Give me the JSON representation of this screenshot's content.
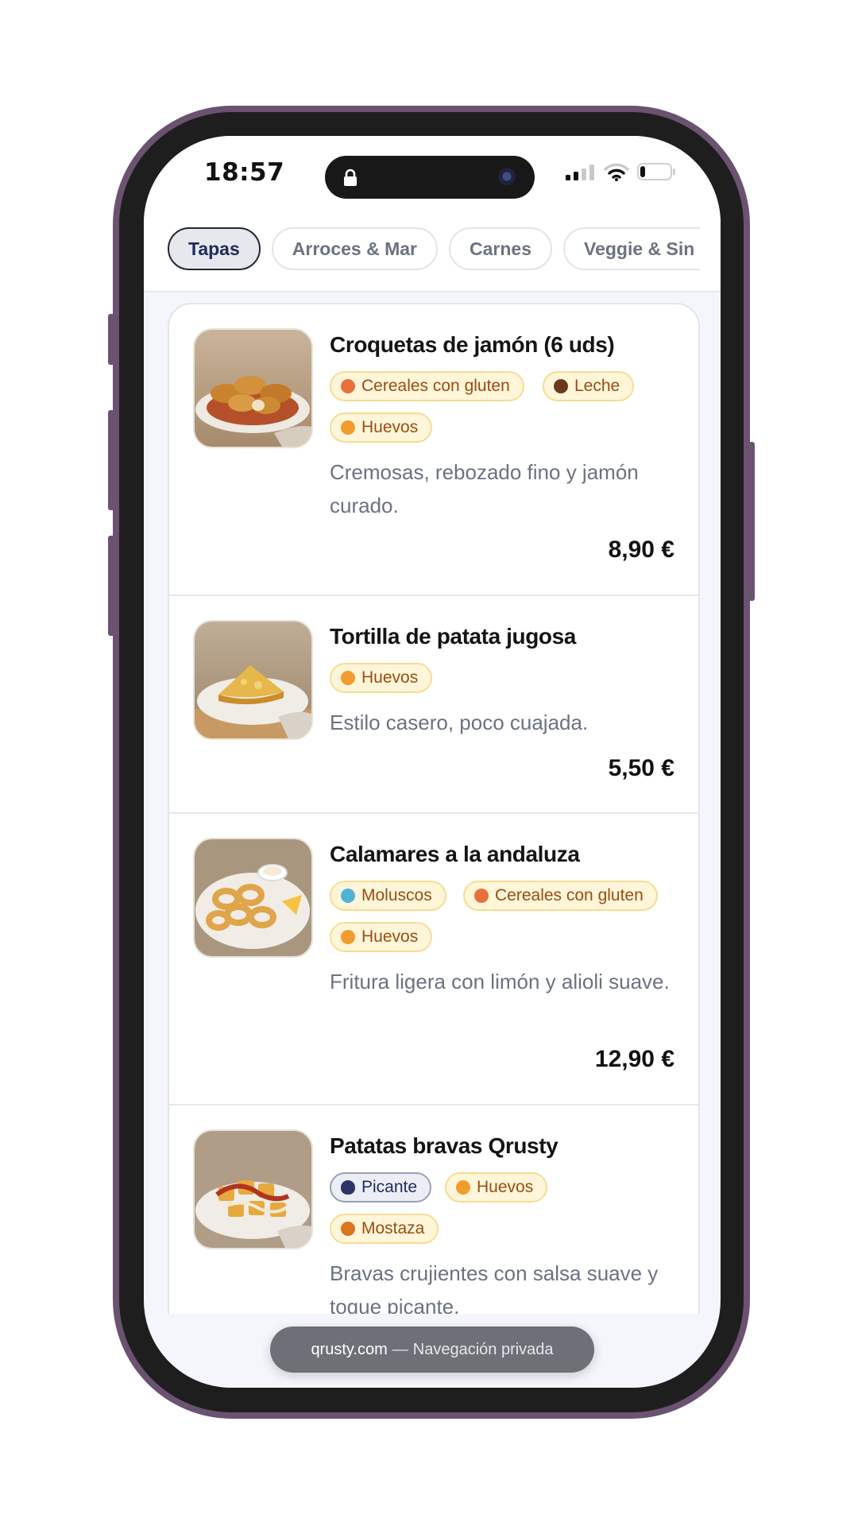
{
  "status_bar": {
    "time": "18:57",
    "icons": [
      "lock-icon",
      "camera-icon",
      "signal-icon",
      "wifi-icon",
      "battery-icon"
    ]
  },
  "tabs": [
    {
      "label": "Tapas",
      "active": true
    },
    {
      "label": "Arroces & Mar",
      "active": false
    },
    {
      "label": "Carnes",
      "active": false
    },
    {
      "label": "Veggie & Sin Gluten",
      "active": false
    }
  ],
  "dishes": [
    {
      "name": "Croquetas de jamón (6 uds)",
      "allergens": [
        {
          "label": "Cereales con gluten",
          "icon": "wheat-icon"
        },
        {
          "label": "Leche",
          "icon": "milk-icon"
        },
        {
          "label": "Huevos",
          "icon": "egg-icon"
        }
      ],
      "description": "Cremosas, rebozado fino y jamón curado.",
      "price": "8,90 €"
    },
    {
      "name": "Tortilla de patata jugosa",
      "allergens": [
        {
          "label": "Huevos",
          "icon": "egg-icon"
        }
      ],
      "description": "Estilo casero, poco cuajada.",
      "price": "5,50 €"
    },
    {
      "name": "Calamares a la andaluza",
      "allergens": [
        {
          "label": "Moluscos",
          "icon": "mollusc-icon"
        },
        {
          "label": "Cereales con gluten",
          "icon": "wheat-icon"
        },
        {
          "label": "Huevos",
          "icon": "egg-icon"
        }
      ],
      "description": "Fritura ligera con limón y alioli suave.",
      "price": "12,90 €"
    },
    {
      "name": "Patatas bravas Qrusty",
      "allergens": [
        {
          "label": "Picante",
          "icon": "flame-icon"
        },
        {
          "label": "Huevos",
          "icon": "egg-icon"
        },
        {
          "label": "Mostaza",
          "icon": "mustard-icon"
        }
      ],
      "description": "Bravas crujientes con salsa suave y toque picante.",
      "price": ""
    }
  ],
  "browser": {
    "domain": "qrusty.com",
    "separator": "—",
    "mode": "Navegación privada"
  },
  "colors": {
    "accent_navy": "#1f2a5c",
    "chip_bg": "#fff6d9",
    "chip_text": "#9a4c12",
    "frame": "#6a5270"
  }
}
